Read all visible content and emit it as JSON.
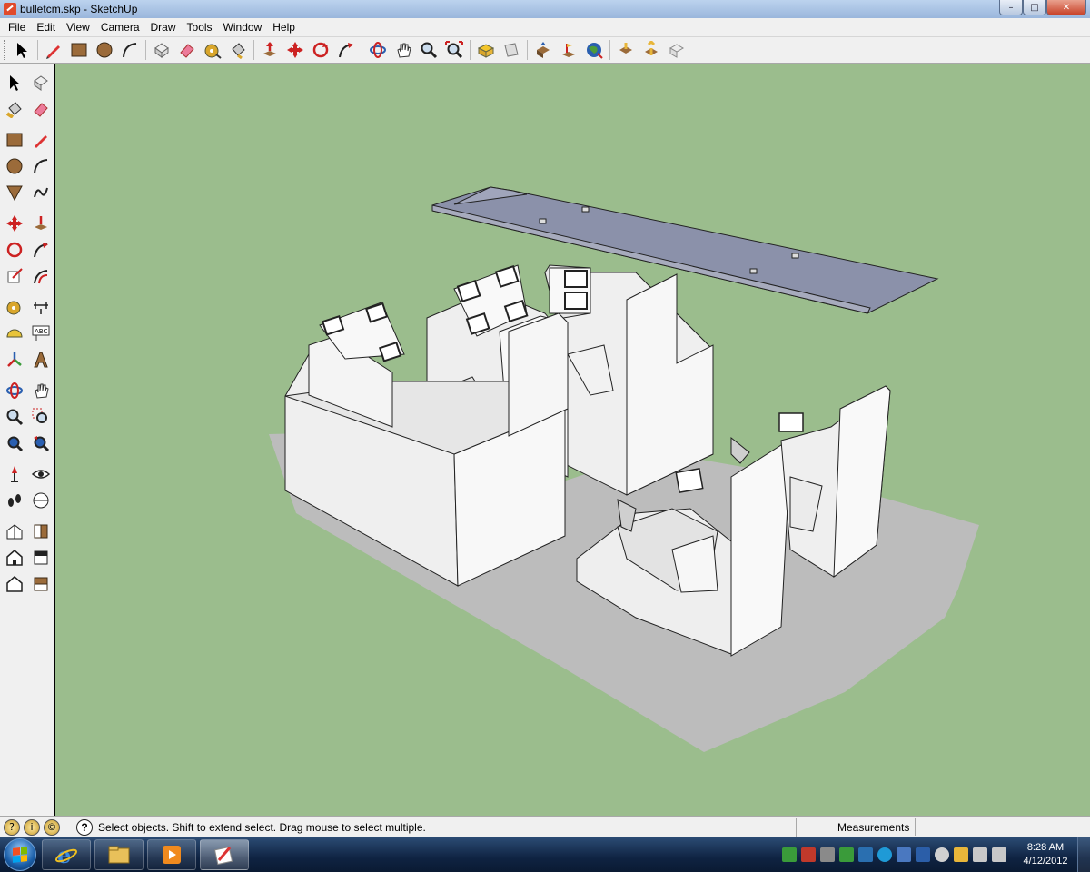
{
  "window": {
    "title": "bulletcm.skp - SketchUp",
    "controls": {
      "minimize": "–",
      "maximize": "□",
      "close": "✕"
    }
  },
  "menu": {
    "items": [
      "File",
      "Edit",
      "View",
      "Camera",
      "Draw",
      "Tools",
      "Window",
      "Help"
    ]
  },
  "top_toolbar": {
    "icons": [
      "select-icon",
      "pencil-icon",
      "rectangle-icon",
      "circle-icon",
      "arc-icon",
      "make-component-icon",
      "eraser-icon",
      "tape-measure-icon",
      "paint-bucket-icon",
      "push-pull-icon",
      "move-icon",
      "rotate-icon",
      "follow-me-icon",
      "orbit-icon",
      "pan-icon",
      "zoom-icon",
      "zoom-extents-icon",
      "get-models-icon",
      "share-model-icon",
      "share-component-icon",
      "add-location-icon",
      "toggle-terrain-icon",
      "preview-google-earth-icon",
      "get-photo-texture-icon",
      "extension-warehouse-icon",
      "send-to-layout-icon"
    ]
  },
  "left_toolbar": {
    "icons": [
      "select-icon",
      "make-component-icon",
      "paint-bucket-icon",
      "eraser-icon",
      "rectangle-icon",
      "pencil-icon",
      "circle-icon",
      "arc-icon",
      "polygon-icon",
      "freehand-icon",
      "move-icon",
      "push-pull-icon",
      "rotate-icon",
      "follow-me-icon",
      "scale-icon",
      "offset-icon",
      "tape-measure-icon",
      "dimension-icon",
      "protractor-icon",
      "text-icon",
      "axes-icon",
      "3d-text-icon",
      "orbit-icon",
      "pan-icon",
      "zoom-icon",
      "zoom-window-icon",
      "zoom-extents-icon",
      "previous-view-icon",
      "position-camera-icon",
      "look-around-icon",
      "walk-icon",
      "section-plane-icon",
      "iso-view-icon",
      "top-view-icon",
      "front-view-icon",
      "right-view-icon",
      "back-view-icon",
      "left-view-icon"
    ],
    "label_abc": "ABC"
  },
  "status_bar": {
    "message": "Select objects. Shift to extend select. Drag mouse to select multiple.",
    "measurements_label": "Measurements",
    "help_glyph": "?"
  },
  "taskbar": {
    "apps": [
      "internet-explorer-icon",
      "file-explorer-icon",
      "media-player-icon",
      "sketchup-icon"
    ],
    "clock_time": "8:28 AM",
    "clock_date": "4/12/2012"
  },
  "colors": {
    "viewport_background": "#9bbd8d",
    "ground_shadow": "#b9b9b9",
    "model_face_light": "#f4f4f4",
    "model_face_shade": "#d8d8d8",
    "roof_panel": "#8b91aa"
  }
}
